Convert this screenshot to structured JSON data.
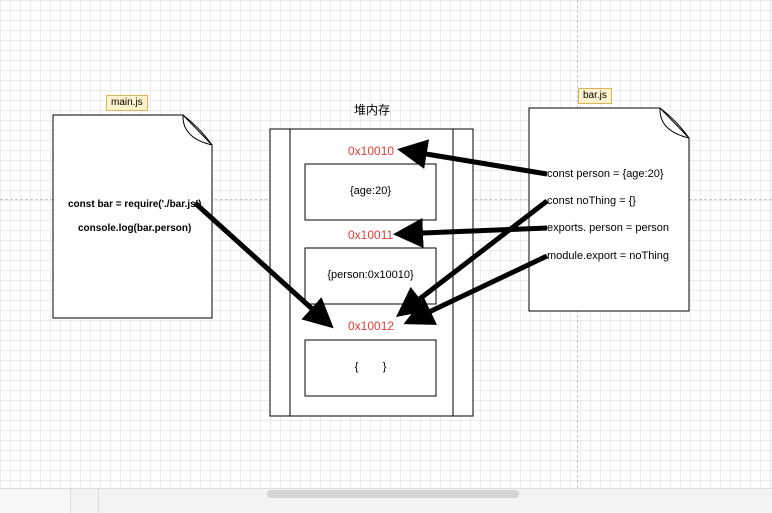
{
  "main_file": {
    "tag": "main.js",
    "lines": [
      "const bar = require('./bar.js')",
      "console.log(bar.person)"
    ]
  },
  "bar_file": {
    "tag": "bar.js",
    "lines": [
      "const person = {age:20}",
      "const noThing = {}",
      "exports. person = person",
      "module.export = noThing"
    ]
  },
  "heap": {
    "title": "堆内存",
    "blocks": [
      {
        "address": "0x10010",
        "content": "{age:20}"
      },
      {
        "address": "0x10011",
        "content": "{person:0x10010}"
      },
      {
        "address": "0x10012",
        "content": "{        }"
      }
    ]
  },
  "colors": {
    "address": "#e0403a",
    "tag_fill": "#fff2cc",
    "tag_border": "#d6b656",
    "arrow": "#000000"
  }
}
